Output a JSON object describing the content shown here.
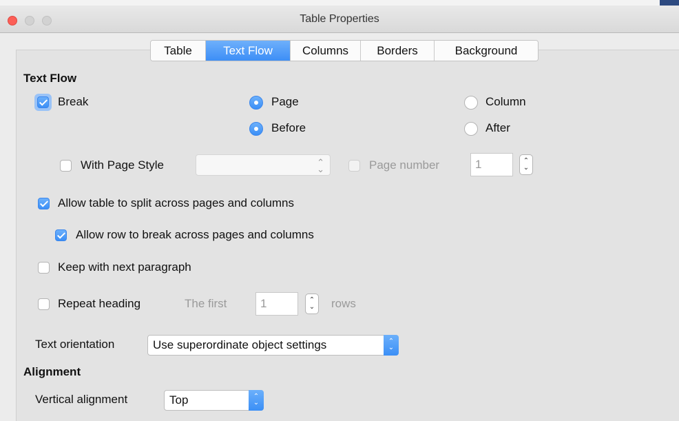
{
  "window": {
    "title": "Table Properties"
  },
  "tabs": [
    {
      "label": "Table",
      "active": false
    },
    {
      "label": "Text Flow",
      "active": true
    },
    {
      "label": "Columns",
      "active": false
    },
    {
      "label": "Borders",
      "active": false
    },
    {
      "label": "Background",
      "active": false
    }
  ],
  "text_flow": {
    "heading": "Text Flow",
    "break": {
      "label": "Break",
      "checked": true
    },
    "break_type": {
      "page_label": "Page",
      "column_label": "Column",
      "selected": "Page"
    },
    "position": {
      "before_label": "Before",
      "after_label": "After",
      "selected": "Before"
    },
    "with_page_style": {
      "label": "With Page Style",
      "checked": false,
      "value": ""
    },
    "page_number": {
      "label": "Page number",
      "checked": false,
      "value": "1"
    },
    "allow_split": {
      "label": "Allow table to split across pages and columns",
      "checked": true
    },
    "allow_row_break": {
      "label": "Allow row to break across pages and columns",
      "checked": true
    },
    "keep_with_next": {
      "label": "Keep with next paragraph",
      "checked": false
    },
    "repeat_heading": {
      "label": "Repeat heading",
      "checked": false,
      "the_first_label": "The first",
      "rows_value": "1",
      "rows_label": "rows"
    },
    "text_orientation": {
      "label": "Text orientation",
      "value": "Use superordinate object settings"
    }
  },
  "alignment": {
    "heading": "Alignment",
    "vertical": {
      "label": "Vertical alignment",
      "value": "Top"
    }
  },
  "colors": {
    "accent": "#3d8ef6",
    "close": "#fc5f57"
  }
}
